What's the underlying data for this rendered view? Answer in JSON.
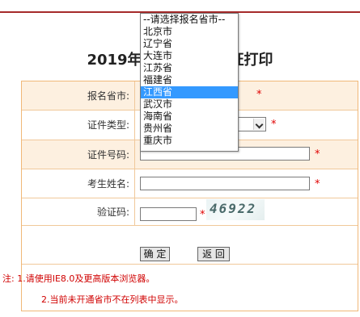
{
  "page": {
    "title": "2019年执业药师准考证打印"
  },
  "form": {
    "province_label": "报名省市:",
    "idtype_label": "证件类型:",
    "idnumber_label": "证件号码:",
    "name_label": "考生姓名:",
    "captcha_label": "验证码:",
    "required_mark": "*",
    "idnumber_value": "",
    "name_value": "",
    "captcha_value": "",
    "captcha_text": "46922",
    "confirm_label": "确 定",
    "back_label": "返 回"
  },
  "notes": {
    "note1": "注: 1.请使用IE8.0及更高版本浏览器。",
    "note2": "2.当前未开通省市不在列表中显示。"
  },
  "dropdown": {
    "options": [
      "--请选择报名省市--",
      "北京市",
      "辽宁省",
      "大连市",
      "江苏省",
      "福建省",
      "江西省",
      "武汉市",
      "海南省",
      "贵州省",
      "重庆市"
    ],
    "selected": "江西省"
  },
  "colors": {
    "accent": "#a52a2a",
    "required": "#e00000",
    "highlight": "#3399ff",
    "row_shade": "#fdf0e0"
  }
}
